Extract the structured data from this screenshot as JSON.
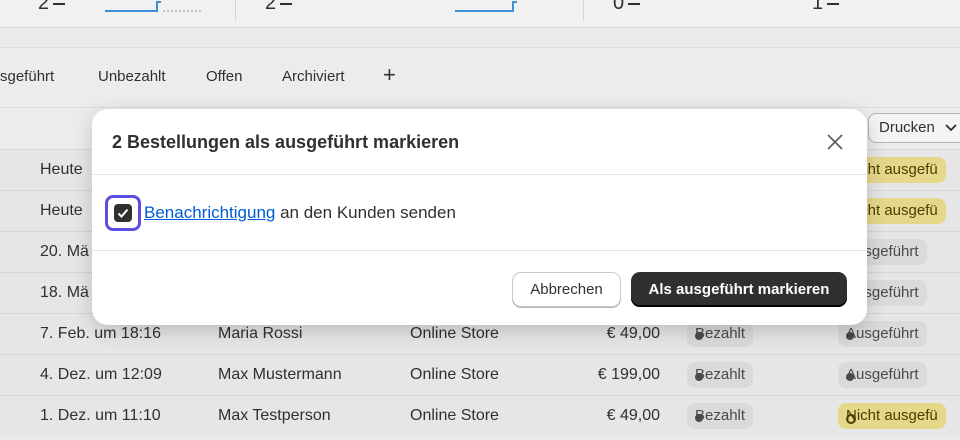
{
  "metrics": [
    {
      "value": "2"
    },
    {
      "value": "2"
    },
    {
      "value": "0"
    },
    {
      "value": "1"
    }
  ],
  "tabs": [
    {
      "label": "sgeführt"
    },
    {
      "label": "Unbezahlt"
    },
    {
      "label": "Offen"
    },
    {
      "label": "Archiviert"
    },
    {
      "label": "+"
    }
  ],
  "toolbar": {
    "print_label": "Drucken"
  },
  "orders": [
    {
      "date": "Heute",
      "customer": "",
      "channel": "",
      "total": "",
      "payment": "",
      "fulfillment": "Nicht ausgefü",
      "fulfillment_style": "yellow"
    },
    {
      "date": "Heute",
      "customer": "",
      "channel": "",
      "total": "",
      "payment": "",
      "fulfillment": "Nicht ausgefü",
      "fulfillment_style": "yellow"
    },
    {
      "date": "20. Mä",
      "customer": "",
      "channel": "",
      "total": "",
      "payment": "",
      "fulfillment": "Ausgeführt",
      "fulfillment_style": "gray"
    },
    {
      "date": "18. Mä",
      "customer": "",
      "channel": "",
      "total": "",
      "payment": "",
      "fulfillment": "Ausgeführt",
      "fulfillment_style": "gray"
    },
    {
      "date": "7. Feb. um 18:16",
      "customer": "Maria Rossi",
      "channel": "Online Store",
      "total": "€ 49,00",
      "payment": "Bezahlt",
      "fulfillment": "Ausgeführt",
      "fulfillment_style": "gray"
    },
    {
      "date": "4. Dez. um 12:09",
      "customer": "Max Mustermann",
      "channel": "Online Store",
      "total": "€ 199,00",
      "payment": "Bezahlt",
      "fulfillment": "Ausgeführt",
      "fulfillment_style": "gray"
    },
    {
      "date": "1. Dez. um 11:10",
      "customer": "Max Testperson",
      "channel": "Online Store",
      "total": "€ 49,00",
      "payment": "Bezahlt",
      "fulfillment": "Nicht ausgefü",
      "fulfillment_style": "yellow"
    }
  ],
  "modal": {
    "title": "2 Bestellungen als ausgeführt markieren",
    "notify_link": "Benachrichtigung",
    "notify_rest": " an den Kunden senden",
    "notify_checked": true,
    "cancel_label": "Abbrechen",
    "confirm_label": "Als ausgeführt markieren"
  },
  "colors": {
    "primary_button": "#303030",
    "link": "#005bd3",
    "focus_ring": "#5a4fe0",
    "badge_unfulfilled": "#e6d88a"
  }
}
